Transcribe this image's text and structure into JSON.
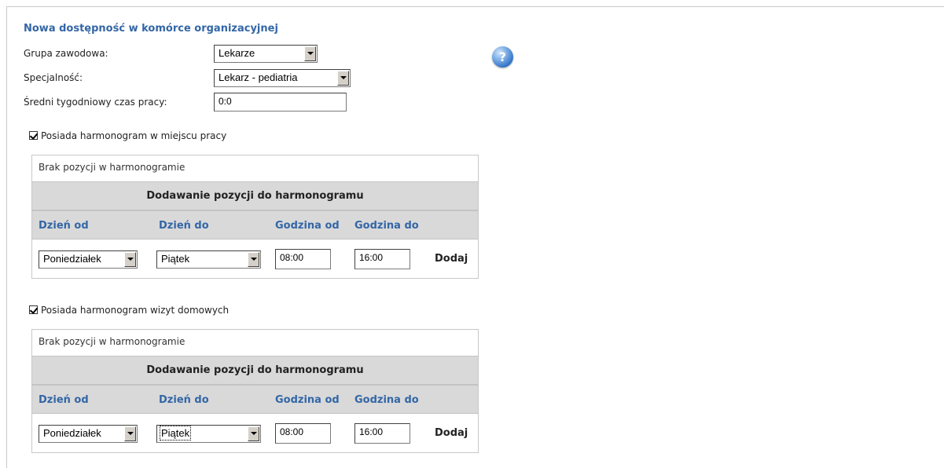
{
  "form": {
    "title": "Nowa dostępność w komórce organizacyjnej",
    "group_label": "Grupa zawodowa:",
    "group_value": "Lekarze",
    "specialty_label": "Specjalność:",
    "specialty_value": "Lekarz - pediatria",
    "avg_time_label": "Średni tygodniowy czas pracy:",
    "avg_time_value": "0:0",
    "help_icon": "question-mark-help-icon",
    "help_glyph": "?"
  },
  "schedules": [
    {
      "checkbox_label": "Posiada harmonogram w miejscu pracy",
      "checked": true,
      "empty_text": "Brak pozycji w harmonogramie",
      "add_header": "Dodawanie pozycji do harmonogramu",
      "col_day_from": "Dzień od",
      "col_day_to": "Dzień do",
      "col_hour_from": "Godzina od",
      "col_hour_to": "Godzina do",
      "day_from_value": "Poniedziałek",
      "day_to_value": "Piątek",
      "hour_from_value": "08:00",
      "hour_to_value": "16:00",
      "add_label": "Dodaj"
    },
    {
      "checkbox_label": "Posiada harmonogram wizyt domowych",
      "checked": true,
      "empty_text": "Brak pozycji w harmonogramie",
      "add_header": "Dodawanie pozycji do harmonogramu",
      "col_day_from": "Dzień od",
      "col_day_to": "Dzień do",
      "col_hour_from": "Godzina od",
      "col_hour_to": "Godzina do",
      "day_from_value": "Poniedziałek",
      "day_to_value": "Piątek",
      "hour_from_value": "08:00",
      "hour_to_value": "16:00",
      "add_label": "Dodaj"
    }
  ],
  "colors": {
    "heading_blue": "#3366a6",
    "band_gray": "#d9d9d9"
  }
}
